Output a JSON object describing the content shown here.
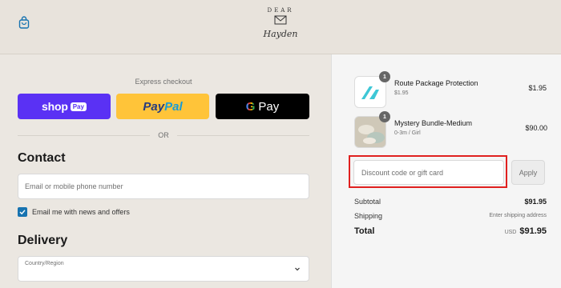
{
  "header": {
    "logo_top_text": "DEAR",
    "logo_script_text": "Hayden"
  },
  "express": {
    "label": "Express checkout",
    "shop_text": "shop",
    "shop_pay_badge": "Pay",
    "paypal_pay": "Pay",
    "paypal_pal": "Pal",
    "gpay_g": "G",
    "gpay_text": "Pay",
    "or_text": "OR"
  },
  "contact": {
    "title": "Contact",
    "email_placeholder": "Email or mobile phone number",
    "newsletter_label": "Email me with news and offers",
    "newsletter_checked": true
  },
  "delivery": {
    "title": "Delivery",
    "country_label": "Country/Region"
  },
  "order": {
    "items": [
      {
        "qty": "1",
        "name": "Route Package Protection",
        "sub": "$1.95",
        "price": "$1.95",
        "thumb_icon": "route-logo-icon"
      },
      {
        "qty": "1",
        "name": "Mystery Bundle-Medium",
        "sub": "0-3m / Girl",
        "price": "$90.00",
        "thumb_icon": "clothing-bundle-photo"
      }
    ],
    "discount_placeholder": "Discount code or gift card",
    "apply_label": "Apply",
    "subtotal_label": "Subtotal",
    "subtotal_value": "$91.95",
    "shipping_label": "Shipping",
    "shipping_value": "Enter shipping address",
    "total_label": "Total",
    "total_currency": "USD",
    "total_value": "$91.95"
  },
  "colors": {
    "highlight": "#e0201f",
    "shop_pay": "#5a31f4",
    "paypal": "#ffc439",
    "checkbox": "#1773b0"
  }
}
